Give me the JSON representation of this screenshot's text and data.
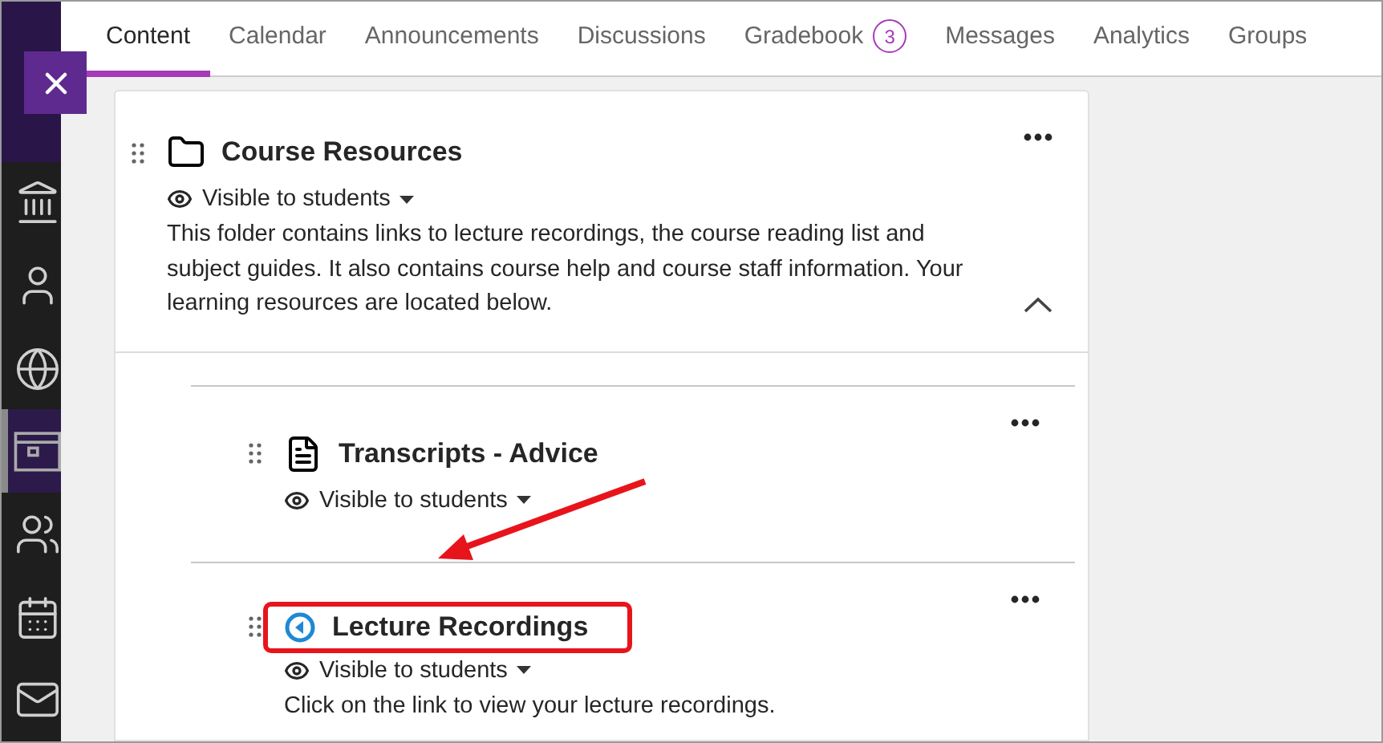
{
  "sidebar": {
    "items": [
      {
        "kind": "institution",
        "selected": false
      },
      {
        "kind": "profile",
        "selected": false
      },
      {
        "kind": "globe",
        "selected": false
      },
      {
        "kind": "courses",
        "selected": true
      },
      {
        "kind": "groups",
        "selected": false
      },
      {
        "kind": "calendar",
        "selected": false
      },
      {
        "kind": "messages",
        "selected": false
      }
    ]
  },
  "tabs": [
    {
      "label": "Content",
      "selected": true
    },
    {
      "label": "Calendar",
      "selected": false
    },
    {
      "label": "Announcements",
      "selected": false
    },
    {
      "label": "Discussions",
      "selected": false
    },
    {
      "label": "Gradebook",
      "badge": "3",
      "selected": false
    },
    {
      "label": "Messages",
      "selected": false
    },
    {
      "label": "Analytics",
      "selected": false
    },
    {
      "label": "Groups",
      "selected": false
    }
  ],
  "content": {
    "items": [
      {
        "kind": "folder",
        "title": "Course Resources",
        "visibility": "Visible to students",
        "description": "This folder contains links to lecture recordings, the course reading list and subject guides. It also contains course help and course staff information. Your learning resources are located below.",
        "expanded": true,
        "highlighted": false,
        "children": [
          {
            "kind": "document",
            "title": "Transcripts - Advice",
            "visibility": "Visible to students",
            "highlighted": false
          },
          {
            "kind": "recording",
            "title": "Lecture Recordings",
            "visibility": "Visible to students",
            "description": "Click on the link to view your lecture recordings.",
            "highlighted": true
          }
        ]
      }
    ]
  }
}
